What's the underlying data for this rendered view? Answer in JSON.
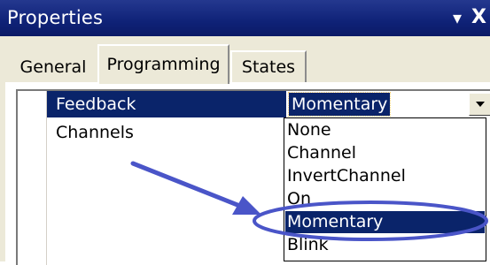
{
  "window": {
    "title": "Properties",
    "pin_glyph": "▾",
    "close_glyph": "X"
  },
  "tabs": [
    {
      "label": "General",
      "active": false
    },
    {
      "label": "Programming",
      "active": true
    },
    {
      "label": "States",
      "active": false
    }
  ],
  "properties": [
    {
      "name": "Feedback",
      "value": "Momentary",
      "selected": true
    },
    {
      "name": "Channels",
      "value": ""
    }
  ],
  "dropdown": {
    "options": [
      "None",
      "Channel",
      "InvertChannel",
      "On",
      "Momentary",
      "Blink"
    ],
    "selected": "Momentary"
  },
  "colors": {
    "title_bar": "#0f2277",
    "selection": "#0a246a",
    "annotation": "#4a55c8"
  },
  "icons": {
    "dropdown_button": "chevron-down-icon",
    "annotation_arrow": "arrow-icon",
    "annotation_highlight": "highlight-ellipse"
  }
}
